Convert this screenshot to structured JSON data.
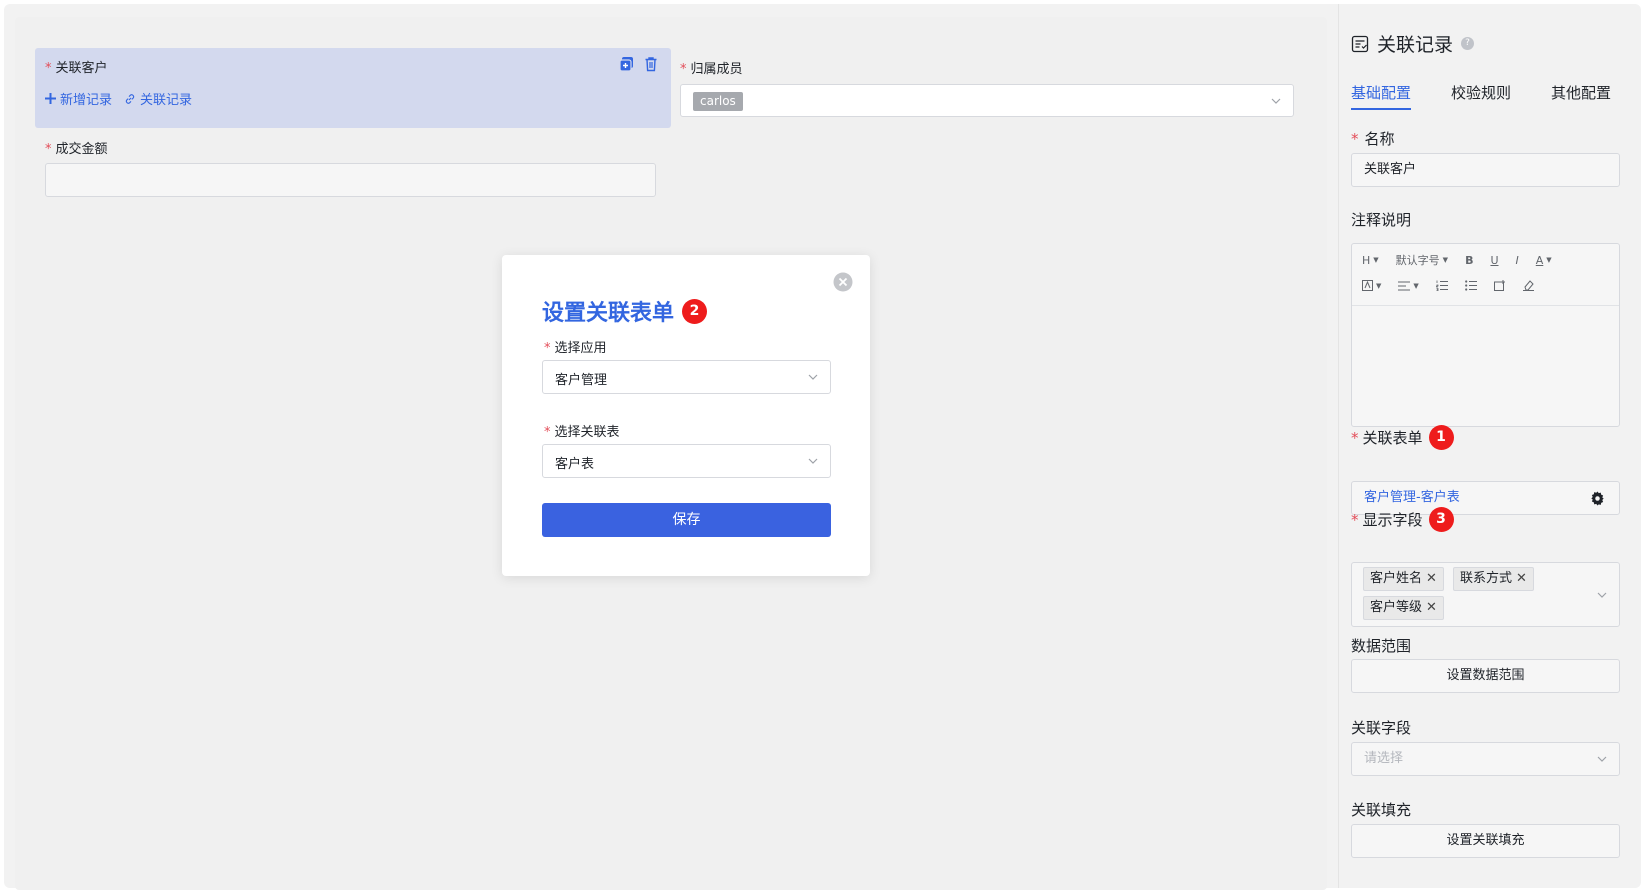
{
  "canvas": {
    "customer_field": {
      "label": "关联客户",
      "add_record": "新增记录",
      "link_record": "关联记录"
    },
    "member_field": {
      "label": "归属成员",
      "tag": "carlos"
    },
    "amount_field": {
      "label": "成交金额",
      "value": ""
    }
  },
  "modal": {
    "title": "设置关联表单",
    "badge": "2",
    "app_label": "选择应用",
    "app_value": "客户管理",
    "table_label": "选择关联表",
    "table_value": "客户表",
    "save": "保存"
  },
  "panel": {
    "title": "关联记录",
    "tabs": [
      "基础配置",
      "校验规则",
      "其他配置"
    ],
    "name_label": "名称",
    "name_value": "关联客户",
    "note_label": "注释说明",
    "editor": {
      "heading": "H",
      "font_size": "默认字号",
      "bold": "B",
      "underline": "U",
      "italic": "I",
      "font_color": "A"
    },
    "linked_form_label": "关联表单",
    "linked_form_badge": "1",
    "linked_form_value": "客户管理-客户表",
    "display_fields_label": "显示字段",
    "display_fields_badge": "3",
    "display_fields": [
      "客户姓名",
      "联系方式",
      "客户等级"
    ],
    "data_range_label": "数据范围",
    "data_range_button": "设置数据范围",
    "link_field_label": "关联字段",
    "link_field_placeholder": "请选择",
    "link_fill_label": "关联填充",
    "link_fill_button": "设置关联填充"
  },
  "colors": {
    "accent": "#3366e0",
    "badge": "#ee1c1c",
    "required": "#e34d59",
    "selected_field_bg": "#d3d9ee"
  }
}
